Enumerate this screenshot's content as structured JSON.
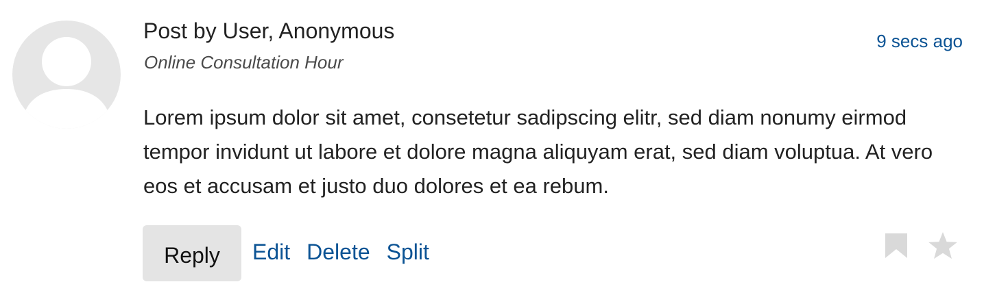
{
  "post": {
    "author": "Post by User, Anonymous",
    "subtitle": "Online Consultation Hour",
    "timestamp": "9 secs ago",
    "body": "Lorem ipsum dolor sit amet, consetetur sadipscing elitr, sed diam nonumy eirmod tempor invidunt ut labore et dolore magna aliquyam erat, sed diam voluptua. At vero eos et accusam et justo duo dolores et ea rebum."
  },
  "actions": {
    "reply_label": "Reply",
    "edit_label": "Edit",
    "delete_label": "Delete",
    "split_label": "Split"
  },
  "icons": {
    "avatar": "user-silhouette-icon",
    "bookmark": "bookmark-icon",
    "favorite": "star-icon"
  },
  "colors": {
    "link": "#0b5394",
    "text": "#222222",
    "muted": "#4a4a4a",
    "avatar_bg": "#e6e6e6",
    "button_bg": "#e4e4e4",
    "icon_gray": "#d9d9d9"
  }
}
